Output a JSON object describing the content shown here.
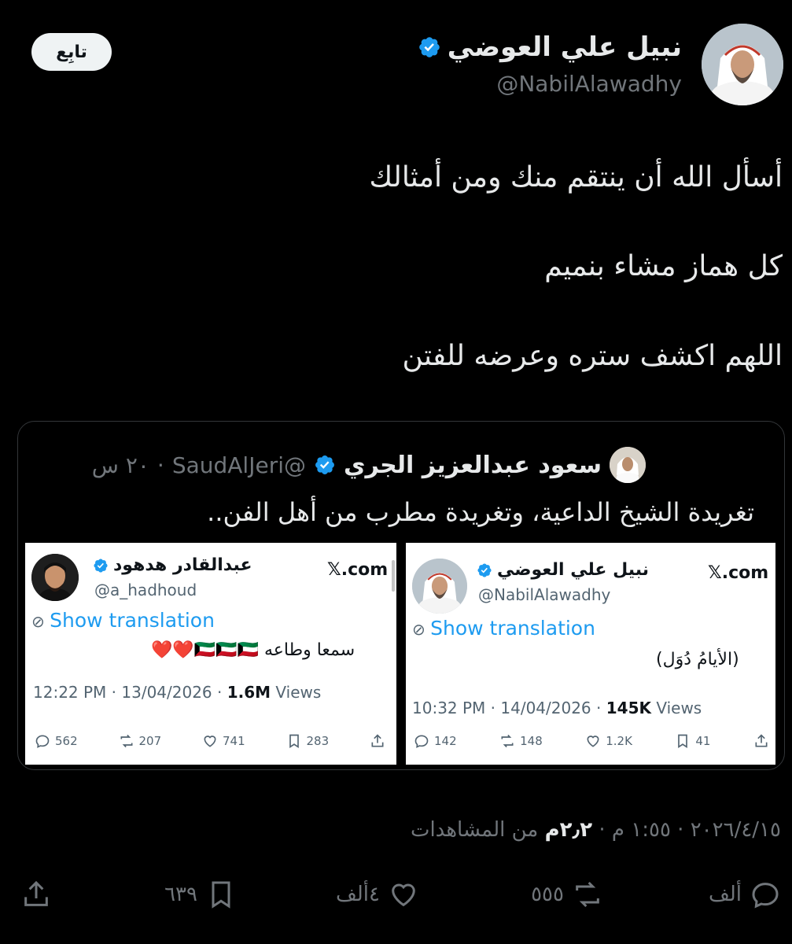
{
  "author": {
    "name": "نبيل علي العوضي",
    "handle": "@NabilAlawadhy",
    "follow_label": "تابِع"
  },
  "tweet": {
    "lines": [
      "أسأل الله أن ينتقم منك ومن أمثالك",
      "كل هماز مشاء بنميم",
      "اللهم اكشف ستره وعرضه للفتن"
    ]
  },
  "quote": {
    "name": "سعود عبدالعزيز الجري",
    "handle": "@SaudAlJeri",
    "time": "٢٠ س",
    "separator": "·",
    "text": "تغريدة الشيخ الداعية، وتغريدة مطرب من أهل الفن.."
  },
  "screenshots": [
    {
      "name": "عبدالقادر هدهود",
      "handle": "@a_hadhoud",
      "site": "𝕏.com",
      "translate": "Show translation",
      "body": "سمعا وطاعه 🇰🇼🇰🇼🇰🇼❤️❤️",
      "meta_prefix": "12:22 PM · 13/04/2026 · ",
      "views_count": "1.6M",
      "views_label": " Views",
      "replies": "562",
      "reposts": "207",
      "likes": "741",
      "bookmarks": "283"
    },
    {
      "name": "نبيل علي العوضي",
      "handle": "@NabilAlawadhy",
      "site": "𝕏.com",
      "translate": "Show translation",
      "body": "(الأيامُ دُوَل)",
      "meta_prefix": "10:32 PM · 14/04/2026 · ",
      "views_count": "145K",
      "views_label": " Views",
      "replies": "142",
      "reposts": "148",
      "likes": "1.2K",
      "bookmarks": "41"
    }
  ],
  "footer": {
    "date_time": "٢٠٢٦/٤/١٥ · ١:٥٥ م · ",
    "views_count": "٢٫٢م",
    "views_label": " من المشاهدات",
    "replies": "ألف",
    "reposts": "٥٥٥",
    "likes": "٤ألف",
    "bookmarks": "٦٣٩"
  },
  "colors": {
    "background": "#000000",
    "verified": "#1d9bf0",
    "muted": "#71767b",
    "text": "#e7e9ea"
  }
}
